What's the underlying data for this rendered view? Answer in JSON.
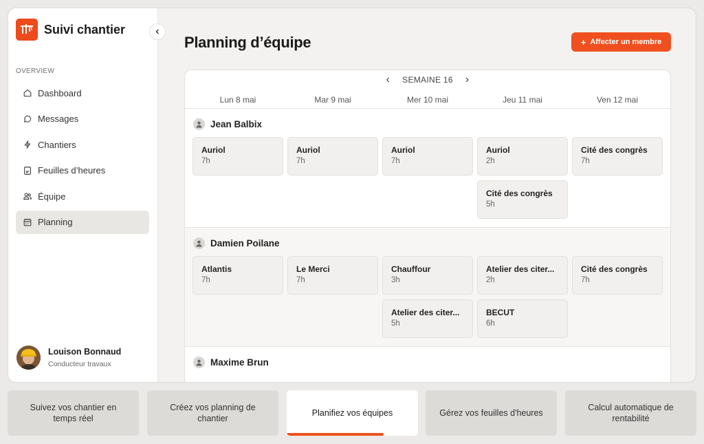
{
  "brand": {
    "name": "Suivi chantier",
    "accent": "#f0501f"
  },
  "sidebar": {
    "section_label": "OVERVIEW",
    "items": [
      {
        "label": "Dashboard",
        "icon": "home-icon"
      },
      {
        "label": "Messages",
        "icon": "chat-icon"
      },
      {
        "label": "Chantiers",
        "icon": "bolt-icon"
      },
      {
        "label": "Feuilles d’heures",
        "icon": "document-icon"
      },
      {
        "label": "Équipe",
        "icon": "users-icon"
      },
      {
        "label": "Planning",
        "icon": "calendar-icon",
        "active": true
      }
    ],
    "user": {
      "name": "Louison Bonnaud",
      "role": "Conducteur travaux"
    }
  },
  "header": {
    "title": "Planning d’équipe",
    "add_button": "Affecter un membre"
  },
  "planning": {
    "week_label": "SEMAINE 16",
    "days": [
      "Lun 8 mai",
      "Mar 9 mai",
      "Mer 10 mai",
      "Jeu 11 mai",
      "Ven 12 mai"
    ],
    "members": [
      {
        "name": "Jean Balbix",
        "cells": [
          [
            {
              "site": "Auriol",
              "hours": "7h"
            }
          ],
          [
            {
              "site": "Auriol",
              "hours": "7h"
            }
          ],
          [
            {
              "site": "Auriol",
              "hours": "7h"
            }
          ],
          [
            {
              "site": "Auriol",
              "hours": "2h"
            },
            {
              "site": "Cité des congrès",
              "hours": "5h"
            }
          ],
          [
            {
              "site": "Cité des congrès",
              "hours": "7h"
            }
          ]
        ]
      },
      {
        "name": "Damien Poilane",
        "cells": [
          [
            {
              "site": "Atlantis",
              "hours": "7h"
            }
          ],
          [
            {
              "site": "Le Merci",
              "hours": "7h"
            }
          ],
          [
            {
              "site": "Chauffour",
              "hours": "3h"
            },
            {
              "site": "Atelier des citer...",
              "hours": "5h"
            }
          ],
          [
            {
              "site": "Atelier des citer...",
              "hours": "2h"
            },
            {
              "site": "BECUT",
              "hours": "6h"
            }
          ],
          [
            {
              "site": "Cité des congrès",
              "hours": "7h"
            }
          ]
        ]
      },
      {
        "name": "Maxime Brun",
        "cells": [
          [],
          [],
          [],
          [],
          []
        ]
      }
    ]
  },
  "feature_tabs": {
    "items": [
      "Suivez vos chantier en temps réel",
      "Créez vos planning de chantier",
      "Planifiez vos équipes",
      "Gérez vos feuilles d'heures",
      "Calcul automatique de rentabilité"
    ],
    "active_index": 2,
    "active_progress": 0.74
  }
}
